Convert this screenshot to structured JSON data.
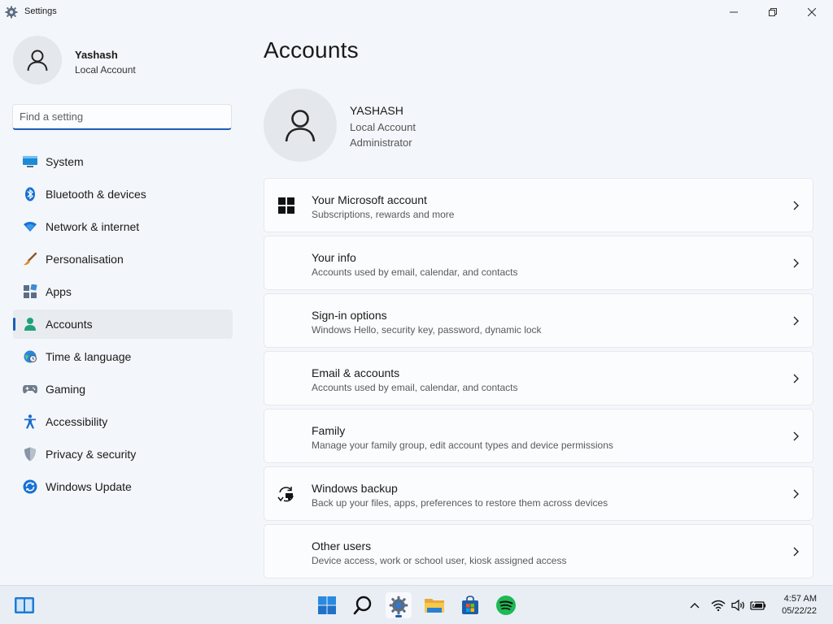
{
  "window": {
    "title": "Settings"
  },
  "user": {
    "name": "Yashash",
    "account_type": "Local Account"
  },
  "search": {
    "placeholder": "Find a setting"
  },
  "sidebar": {
    "items": [
      {
        "label": "System",
        "icon": "system-icon"
      },
      {
        "label": "Bluetooth & devices",
        "icon": "bluetooth-icon"
      },
      {
        "label": "Network & internet",
        "icon": "wifi-icon"
      },
      {
        "label": "Personalisation",
        "icon": "brush-icon"
      },
      {
        "label": "Apps",
        "icon": "apps-icon"
      },
      {
        "label": "Accounts",
        "icon": "accounts-icon",
        "active": true
      },
      {
        "label": "Time & language",
        "icon": "globe-clock-icon"
      },
      {
        "label": "Gaming",
        "icon": "gamepad-icon"
      },
      {
        "label": "Accessibility",
        "icon": "accessibility-icon"
      },
      {
        "label": "Privacy & security",
        "icon": "shield-icon"
      },
      {
        "label": "Windows Update",
        "icon": "update-icon"
      }
    ]
  },
  "main": {
    "title": "Accounts",
    "profile": {
      "name": "YASHASH",
      "line1": "Local Account",
      "line2": "Administrator"
    },
    "cards": [
      {
        "title": "Your Microsoft account",
        "subtitle": "Subscriptions, rewards and more",
        "icon": "windows-logo-icon"
      },
      {
        "title": "Your info",
        "subtitle": "Accounts used by email, calendar, and contacts",
        "icon": ""
      },
      {
        "title": "Sign-in options",
        "subtitle": "Windows Hello, security key, password, dynamic lock",
        "icon": ""
      },
      {
        "title": "Email & accounts",
        "subtitle": "Accounts used by email, calendar, and contacts",
        "icon": ""
      },
      {
        "title": "Family",
        "subtitle": "Manage your family group, edit account types and device permissions",
        "icon": ""
      },
      {
        "title": "Windows backup",
        "subtitle": "Back up your files, apps, preferences to restore them across devices",
        "icon": "backup-sync-icon"
      },
      {
        "title": "Other users",
        "subtitle": "Device access, work or school user, kiosk assigned access",
        "icon": ""
      }
    ]
  },
  "taskbar": {
    "time": "4:57 AM",
    "date": "05/22/22"
  },
  "colors": {
    "accent": "#1a5fb4",
    "window_bg": "#f3f6fa",
    "card_bg": "#fbfcfd",
    "taskbar_bg": "#e9eef5"
  }
}
